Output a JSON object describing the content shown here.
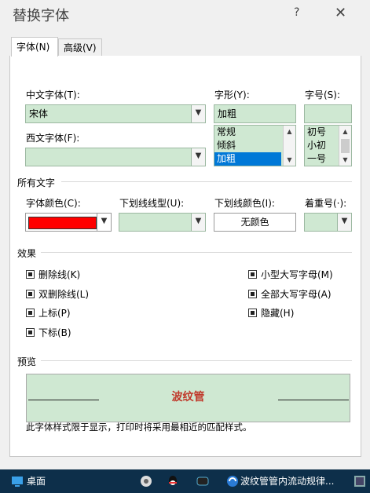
{
  "dialog": {
    "title": "替换字体",
    "help": "?",
    "close": "✕",
    "tabs": [
      {
        "label": "字体(N)",
        "active": true
      },
      {
        "label": "高级(V)",
        "active": false
      }
    ]
  },
  "font": {
    "cn_font_label": "中文字体(T):",
    "cn_font_value": "宋体",
    "west_font_label": "西文字体(F):",
    "west_font_value": "",
    "style_label": "字形(Y):",
    "style_value": "加粗",
    "style_options": [
      "常规",
      "倾斜",
      "加粗"
    ],
    "style_selected": "加粗",
    "size_label": "字号(S):",
    "size_value": "",
    "size_options": [
      "初号",
      "小初",
      "一号"
    ]
  },
  "all_text": {
    "section_label": "所有文字",
    "color_label": "字体颜色(C):",
    "color_value": "#ff0000",
    "underline_label": "下划线线型(U):",
    "underline_value": "",
    "underline_color_label": "下划线颜色(I):",
    "underline_color_value": "无颜色",
    "emphasis_label": "着重号(·):",
    "emphasis_value": ""
  },
  "effects": {
    "section_label": "效果",
    "left": [
      {
        "label": "删除线(K)",
        "checked": true
      },
      {
        "label": "双删除线(L)",
        "checked": true
      },
      {
        "label": "上标(P)",
        "checked": true
      },
      {
        "label": "下标(B)",
        "checked": true
      }
    ],
    "right": [
      {
        "label": "小型大写字母(M)",
        "checked": true
      },
      {
        "label": "全部大写字母(A)",
        "checked": true
      },
      {
        "label": "隐藏(H)",
        "checked": true
      }
    ]
  },
  "preview": {
    "section_label": "预览",
    "sample": "波纹管",
    "note": "此字体样式限于显示，打印时将采用最相近的匹配样式。"
  },
  "taskbar": {
    "desktop_label": "桌面",
    "window_label": "波纹管管内流动规律...",
    "colors": {
      "bg": "#0d2f4a"
    }
  },
  "colors": {
    "field_bg": "#cfe8d2",
    "selection": "#0078d7",
    "preview_text": "#c0392b"
  }
}
